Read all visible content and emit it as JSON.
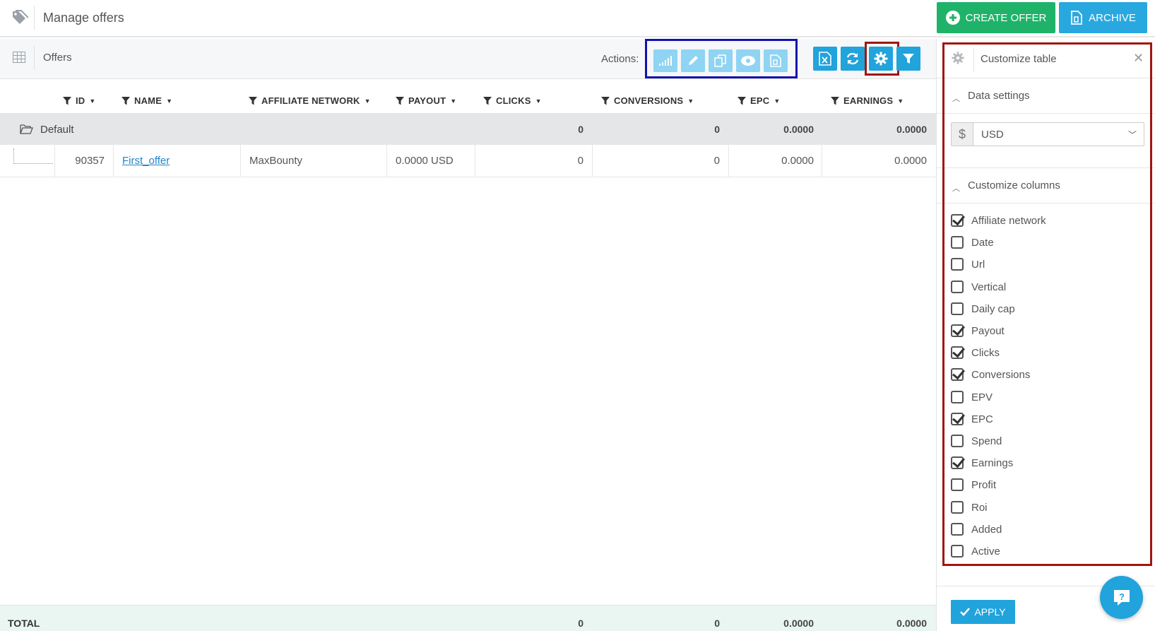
{
  "header": {
    "title": "Manage offers",
    "create_label": "CREATE OFFER",
    "archive_label": "ARCHIVE"
  },
  "toolbar": {
    "title": "Offers",
    "actions_label": "Actions:"
  },
  "table": {
    "columns": [
      "ID",
      "NAME",
      "AFFILIATE NETWORK",
      "PAYOUT",
      "CLICKS",
      "CONVERSIONS",
      "EPC",
      "EARNINGS"
    ],
    "group": {
      "name": "Default",
      "clicks": "0",
      "conversions": "0",
      "epc": "0.0000",
      "earnings": "0.0000"
    },
    "rows": [
      {
        "id": "90357",
        "name": "First_offer",
        "network": "MaxBounty",
        "payout": "0.0000 USD",
        "clicks": "0",
        "conversions": "0",
        "epc": "0.0000",
        "earnings": "0.0000"
      }
    ],
    "total": {
      "label": "TOTAL",
      "clicks": "0",
      "conversions": "0",
      "epc": "0.0000",
      "earnings": "0.0000"
    }
  },
  "panel": {
    "title": "Customize table",
    "data_settings": "Data settings",
    "currency_symbol": "$",
    "currency": "USD",
    "customize_columns": "Customize columns",
    "columns": [
      {
        "label": "Affiliate network",
        "checked": true
      },
      {
        "label": "Date",
        "checked": false
      },
      {
        "label": "Url",
        "checked": false
      },
      {
        "label": "Vertical",
        "checked": false
      },
      {
        "label": "Daily cap",
        "checked": false
      },
      {
        "label": "Payout",
        "checked": true
      },
      {
        "label": "Clicks",
        "checked": true
      },
      {
        "label": "Conversions",
        "checked": true
      },
      {
        "label": "EPV",
        "checked": false
      },
      {
        "label": "EPC",
        "checked": true
      },
      {
        "label": "Spend",
        "checked": false
      },
      {
        "label": "Earnings",
        "checked": true
      },
      {
        "label": "Profit",
        "checked": false
      },
      {
        "label": "Roi",
        "checked": false
      },
      {
        "label": "Added",
        "checked": false
      },
      {
        "label": "Active",
        "checked": false
      }
    ],
    "apply_label": "APPLY"
  },
  "colors": {
    "green": "#1fb36a",
    "blue": "#21a3dc",
    "light_blue": "#8fd4f2",
    "highlight_red": "#a0160f",
    "highlight_navy": "#1212b0"
  }
}
